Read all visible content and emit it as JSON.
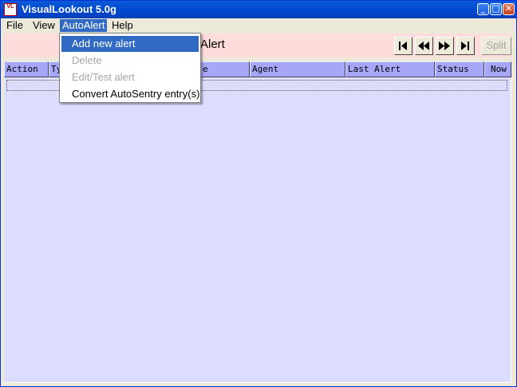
{
  "window": {
    "title": "VisualLookout 5.0g",
    "icon": "app-icon-vl",
    "icon_text": "VL"
  },
  "title_controls": {
    "minimize": "_",
    "maximize": "□",
    "close": "✕"
  },
  "menubar": {
    "items": [
      "File",
      "View",
      "AutoAlert",
      "Help"
    ],
    "active_index": 2
  },
  "dropdown": {
    "items": [
      {
        "label": "Add new alert",
        "state": "highlighted"
      },
      {
        "label": "Delete",
        "state": "disabled"
      },
      {
        "label": "Edit/Test alert",
        "state": "disabled"
      },
      {
        "label": "Convert AutoSentry entry(s)",
        "state": "enabled"
      }
    ]
  },
  "header": {
    "title_partial": "Alert",
    "nav_buttons": [
      "first-icon",
      "previous-icon",
      "next-icon",
      "last-icon"
    ],
    "split_label": "Split"
  },
  "table": {
    "columns": [
      "Action",
      "Type",
      "Node",
      "Agent",
      "Last Alert",
      "Status",
      "Now"
    ],
    "columns_visible_text": [
      "Action",
      "Ty",
      "e",
      "Agent",
      "Last Alert",
      "Status",
      "Now"
    ],
    "rows": []
  },
  "colors": {
    "titlebar": "#0a5bd9",
    "menu_highlight": "#316ac5",
    "header_band": "#ffdcdc",
    "column_header": "#a8a6f8",
    "table_background": "#dcdcfc"
  }
}
